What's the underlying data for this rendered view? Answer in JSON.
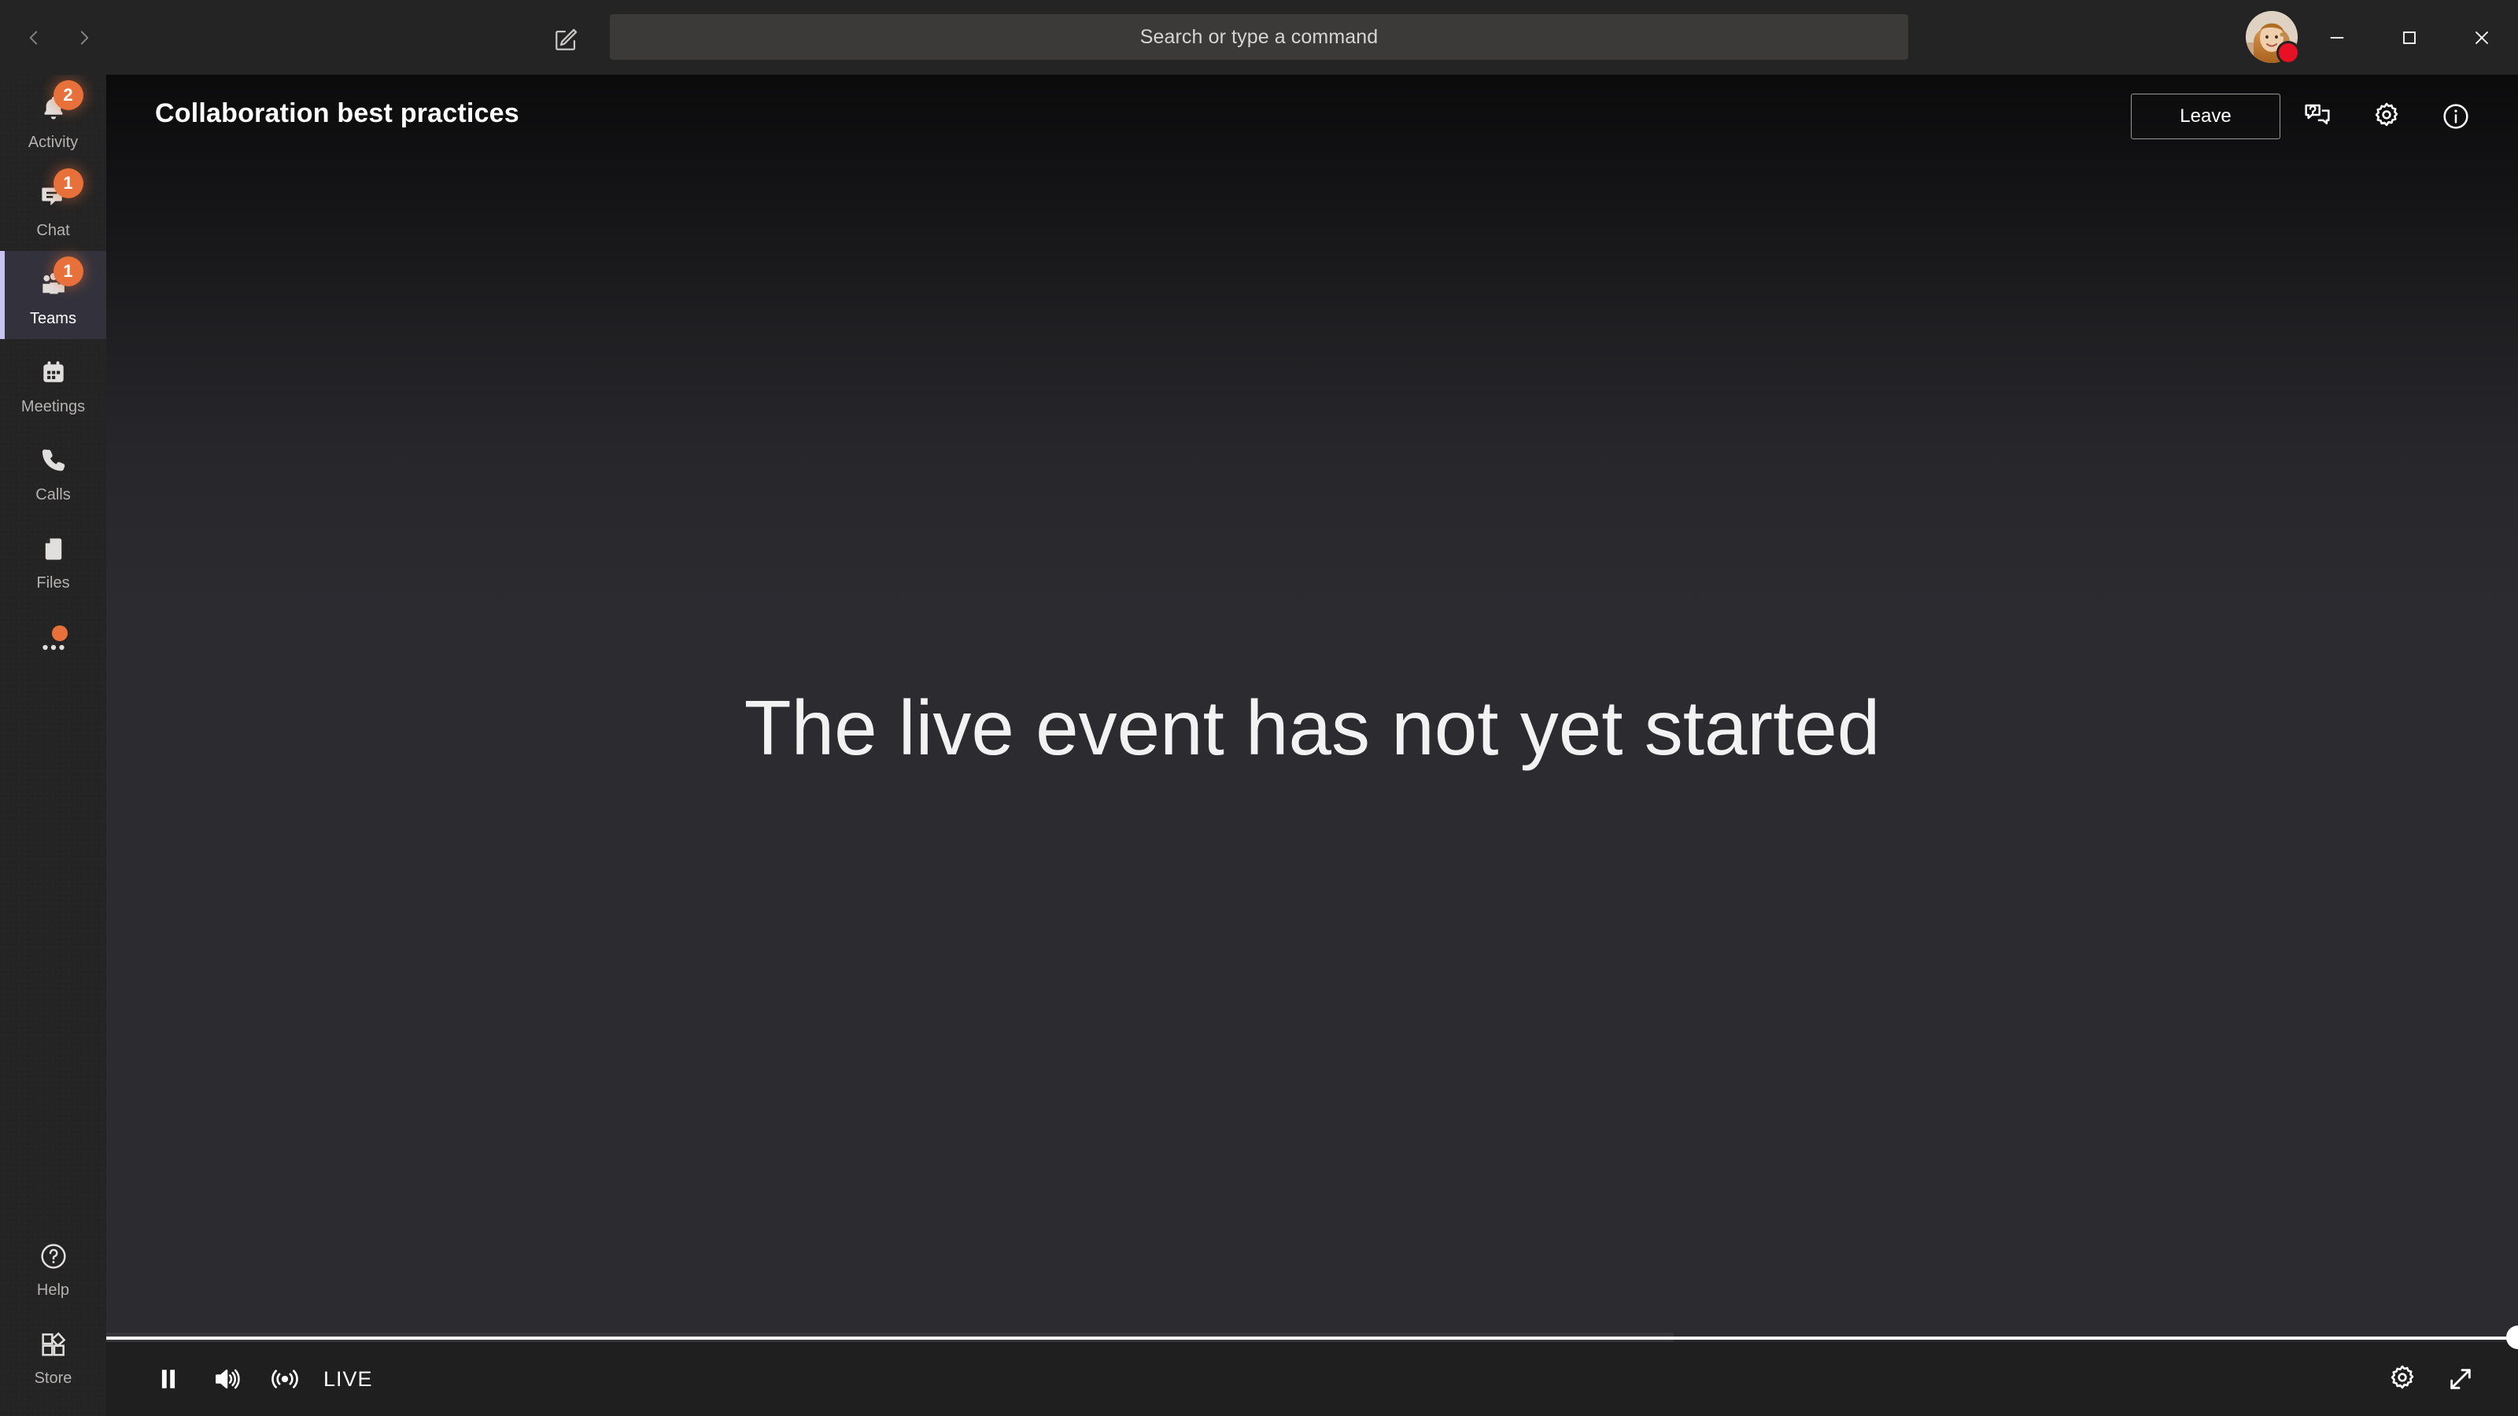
{
  "titlebar": {
    "back_label": "Back",
    "forward_label": "Forward",
    "compose_label": "New chat",
    "search": {
      "placeholder": "Search or type a command",
      "value": ""
    },
    "avatar_alt": "User profile photo",
    "presence": "Do not disturb",
    "presence_color": "#e81123",
    "minimize_label": "Minimize",
    "maximize_label": "Maximize",
    "close_label": "Close"
  },
  "rail": {
    "items": [
      {
        "id": "activity",
        "label": "Activity",
        "icon": "bell-icon",
        "badge": "2",
        "active": false
      },
      {
        "id": "chat",
        "label": "Chat",
        "icon": "chat-icon",
        "badge": "1",
        "active": false
      },
      {
        "id": "teams",
        "label": "Teams",
        "icon": "teams-icon",
        "badge": "1",
        "active": true
      },
      {
        "id": "meetings",
        "label": "Meetings",
        "icon": "calendar-icon",
        "badge": "",
        "active": false
      },
      {
        "id": "calls",
        "label": "Calls",
        "icon": "phone-icon",
        "badge": "",
        "active": false
      },
      {
        "id": "files",
        "label": "Files",
        "icon": "file-icon",
        "badge": "",
        "active": false
      },
      {
        "id": "more",
        "label": "",
        "icon": "ellipsis-icon",
        "badge": "",
        "active": false
      }
    ],
    "bottom_items": [
      {
        "id": "help",
        "label": "Help",
        "icon": "question-circle-icon"
      },
      {
        "id": "store",
        "label": "Store",
        "icon": "store-icon"
      }
    ],
    "active_indicator_color": "#c8c4ef",
    "badge_color": "#e8703a"
  },
  "event": {
    "title": "Collaboration best practices",
    "leave_label": "Leave",
    "qa_label": "Q&A",
    "settings_label": "Settings",
    "info_label": "Event info",
    "stage_message": "The live event has not yet started"
  },
  "player": {
    "pause_label": "Pause",
    "volume_label": "Volume",
    "live_label": "LIVE",
    "settings_label": "Settings",
    "fullscreen_label": "Full screen",
    "progress_percent": 100,
    "buffered_percent": 65
  }
}
